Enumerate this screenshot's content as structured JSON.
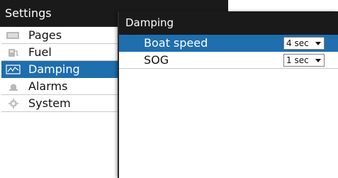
{
  "settings": {
    "title": "Settings",
    "items": [
      {
        "label": "Pages",
        "icon": "pages-icon"
      },
      {
        "label": "Fuel",
        "icon": "fuel-icon"
      },
      {
        "label": "Damping",
        "icon": "damping-icon",
        "selected": true
      },
      {
        "label": "Alarms",
        "icon": "alarms-icon"
      },
      {
        "label": "System",
        "icon": "system-icon"
      }
    ]
  },
  "dialog": {
    "title": "Damping",
    "rows": [
      {
        "label": "Boat speed",
        "value": "4 sec",
        "selected": true
      },
      {
        "label": "SOG",
        "value": "1 sec"
      }
    ]
  },
  "colors": {
    "titlebar": "#1a1a1a",
    "selection": "#1f6ead",
    "divider": "#c9c9c9"
  }
}
